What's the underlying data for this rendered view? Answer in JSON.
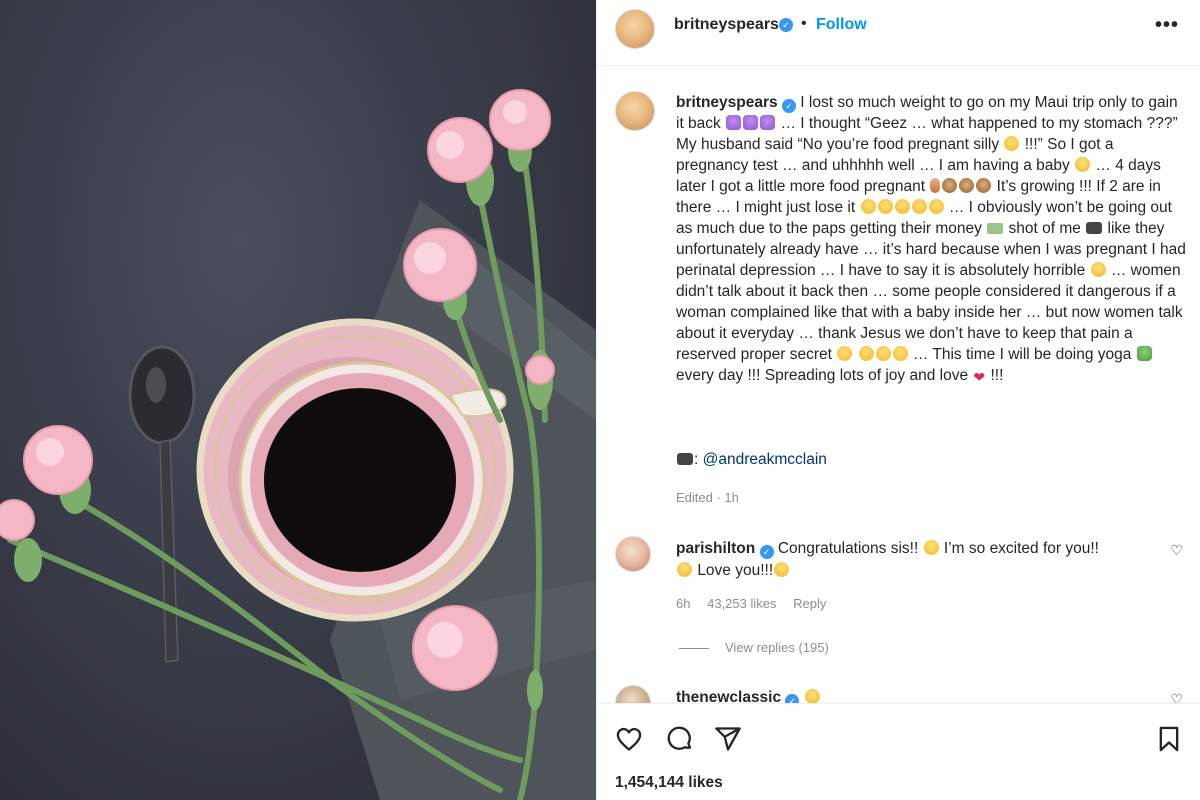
{
  "header": {
    "username": "britneyspears",
    "verified_icon": "verified-badge-icon",
    "separator": "•",
    "follow_label": "Follow",
    "more_label": "•••"
  },
  "caption": {
    "username": "britneyspears",
    "segments": [
      "I lost so much weight to go on my Maui trip only to gain it back",
      "… I thought “Geez … what happened to my stomach ???” My husband said “No you’re food pregnant silly",
      "!!!” So I got a pregnancy test … and uhhhhh well … I am having a baby",
      "… 4 days later I got a little more food pregnant",
      "It’s growing !!! If 2 are in there … I might just lose it",
      "… I obviously won’t be going out as much due to the paps getting their money",
      "shot of me",
      "like they unfortunately already have … it’s hard because when I was pregnant I had perinatal depression … I have to say it is absolutely horrible",
      "… women didn’t talk about it back then … some people considered it dangerous if a woman complained like that with a baby inside her … but now women talk about it everyday … thank Jesus we don’t have to keep that pain a reserved proper secret",
      "… This time I will be doing yoga",
      "every day !!! Spreading lots of joy and love",
      "!!!"
    ],
    "credit_suffix": ":",
    "credit_handle": "@andreakmcclain",
    "meta": "Edited · 1h"
  },
  "comments": [
    {
      "username": "parishilton",
      "text_a": "Congratulations sis!!",
      "text_b": "I’m so excited for you!!",
      "text_c": "Love you!!!",
      "time": "6h",
      "likes": "43,253 likes",
      "reply_label": "Reply"
    },
    {
      "username": "thenewclassic"
    }
  ],
  "view_replies": "View replies (195)",
  "actions": {
    "likes": "1,454,144 likes"
  },
  "icons": {
    "like": "heart-outline-icon",
    "comment": "comment-bubble-icon",
    "share": "paper-plane-icon",
    "save": "bookmark-icon"
  },
  "colors": {
    "follow": "#0095f6",
    "verified": "#3897f0",
    "link": "#00376b",
    "muted": "#8e8e8e"
  }
}
